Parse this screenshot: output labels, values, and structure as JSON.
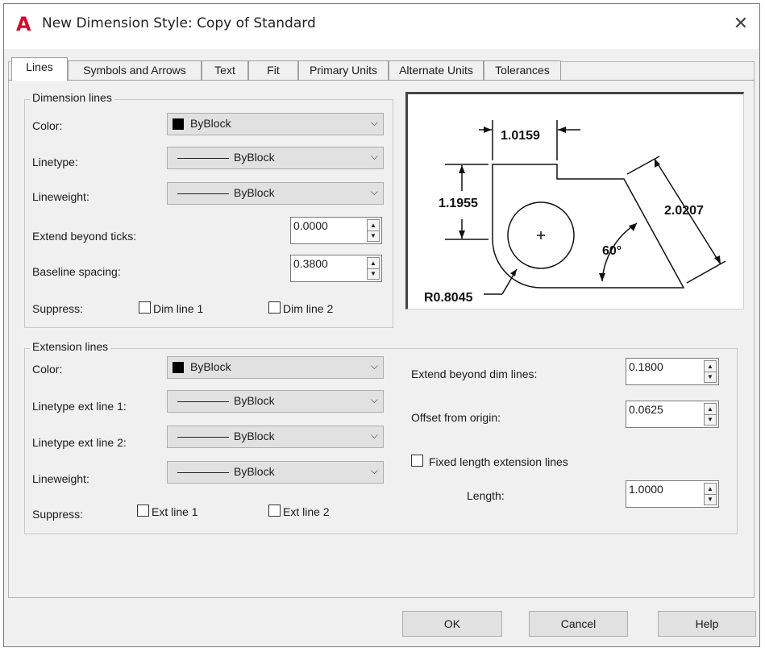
{
  "window": {
    "title": "New Dimension Style: Copy of Standard",
    "app_icon": "A",
    "close_glyph": "✕"
  },
  "tabs": [
    "Lines",
    "Symbols and Arrows",
    "Text",
    "Fit",
    "Primary Units",
    "Alternate Units",
    "Tolerances"
  ],
  "dimension_lines": {
    "group_label": "Dimension lines",
    "color_label": "Color:",
    "color_value": "ByBlock",
    "linetype_label": "Linetype:",
    "linetype_value": "ByBlock",
    "lineweight_label": "Lineweight:",
    "lineweight_value": "ByBlock",
    "extend_label": "Extend beyond ticks:",
    "extend_value": "0.0000",
    "baseline_label": "Baseline spacing:",
    "baseline_value": "0.3800",
    "suppress_label": "Suppress:",
    "dim_line1": "Dim line 1",
    "dim_line2": "Dim line 2"
  },
  "extension_lines": {
    "group_label": "Extension lines",
    "color_label": "Color:",
    "color_value": "ByBlock",
    "lt1_label": "Linetype ext line 1:",
    "lt1_value": "ByBlock",
    "lt2_label": "Linetype ext line 2:",
    "lt2_value": "ByBlock",
    "lineweight_label": "Lineweight:",
    "lineweight_value": "ByBlock",
    "suppress_label": "Suppress:",
    "ext_line1": "Ext line 1",
    "ext_line2": "Ext line 2",
    "extend_dim_label": "Extend beyond dim lines:",
    "extend_dim_value": "0.1800",
    "offset_label": "Offset from origin:",
    "offset_value": "0.0625",
    "fixed_label": "Fixed length extension lines",
    "length_label": "Length:",
    "length_value": "1.0000"
  },
  "preview": {
    "dim_top": "1.0159",
    "dim_left": "1.1955",
    "dim_right": "2.0207",
    "angle": "60°",
    "radius": "R0.8045"
  },
  "buttons": {
    "ok": "OK",
    "cancel": "Cancel",
    "help": "Help"
  },
  "colors": {
    "accent_icon": "#c8102e",
    "dialog_bg": "#f0f0f0"
  }
}
